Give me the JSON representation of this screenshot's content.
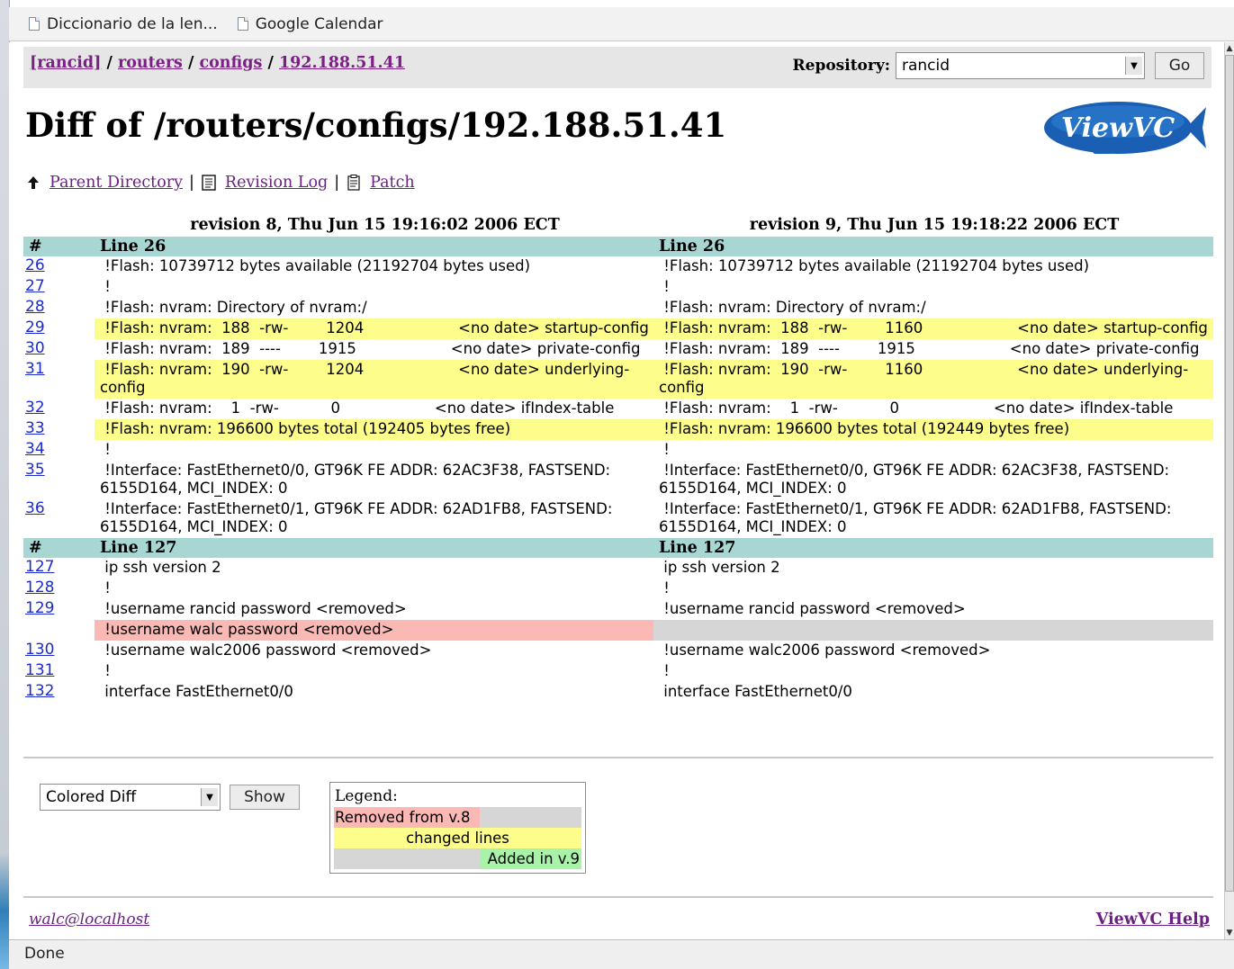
{
  "bookmarks": [
    {
      "label": "Diccionario de la len..."
    },
    {
      "label": "Google Calendar"
    }
  ],
  "breadcrumb": {
    "items": [
      "[rancid]",
      "routers",
      "configs",
      "192.188.51.41"
    ],
    "separator": "/"
  },
  "repository": {
    "label": "Repository:",
    "value": "rancid",
    "go_label": "Go"
  },
  "page_title": "Diff of /routers/configs/192.188.51.41",
  "logo_text": "ViewVC",
  "nav": {
    "parent": "Parent Directory",
    "log": "Revision Log",
    "patch": "Patch"
  },
  "diff": {
    "left_rev": "revision 8, Thu Jun 15 19:16:02 2006 ECT",
    "right_rev": "revision 9, Thu Jun 15 19:18:22 2006 ECT",
    "hash": "#",
    "hunks": [
      {
        "left_line": "Line 26",
        "right_line": "Line 26",
        "rows": [
          {
            "n": "26",
            "left": " !Flash: 10739712 bytes available (21192704 bytes used)",
            "right": " !Flash: 10739712 bytes available (21192704 bytes used)",
            "kind": "same"
          },
          {
            "n": "27",
            "left": " !",
            "right": " !",
            "kind": "same"
          },
          {
            "n": "28",
            "left": " !Flash: nvram: Directory of nvram:/",
            "right": " !Flash: nvram: Directory of nvram:/",
            "kind": "same"
          },
          {
            "n": "29",
            "left": " !Flash: nvram:  188  -rw-        1204                    <no date> startup-config",
            "right": " !Flash: nvram:  188  -rw-        1160                    <no date> startup-config",
            "kind": "changed"
          },
          {
            "n": "30",
            "left": " !Flash: nvram:  189  ----        1915                    <no date> private-config",
            "right": " !Flash: nvram:  189  ----        1915                    <no date> private-config",
            "kind": "same"
          },
          {
            "n": "31",
            "left": " !Flash: nvram:  190  -rw-        1204                    <no date> underlying-config",
            "right": " !Flash: nvram:  190  -rw-        1160                    <no date> underlying-config",
            "kind": "changed"
          },
          {
            "n": "32",
            "left": " !Flash: nvram:    1  -rw-           0                    <no date> ifIndex-table",
            "right": " !Flash: nvram:    1  -rw-           0                    <no date> ifIndex-table",
            "kind": "same"
          },
          {
            "n": "33",
            "left": " !Flash: nvram: 196600 bytes total (192405 bytes free)",
            "right": " !Flash: nvram: 196600 bytes total (192449 bytes free)",
            "kind": "changed"
          },
          {
            "n": "34",
            "left": " !",
            "right": " !",
            "kind": "same"
          },
          {
            "n": "35",
            "left": " !Interface: FastEthernet0/0, GT96K FE ADDR: 62AC3F38, FASTSEND: 6155D164, MCI_INDEX: 0",
            "right": " !Interface: FastEthernet0/0, GT96K FE ADDR: 62AC3F38, FASTSEND: 6155D164, MCI_INDEX: 0",
            "kind": "same"
          },
          {
            "n": "36",
            "left": " !Interface: FastEthernet0/1, GT96K FE ADDR: 62AD1FB8, FASTSEND: 6155D164, MCI_INDEX: 0",
            "right": " !Interface: FastEthernet0/1, GT96K FE ADDR: 62AD1FB8, FASTSEND: 6155D164, MCI_INDEX: 0",
            "kind": "same"
          }
        ]
      },
      {
        "left_line": "Line 127",
        "right_line": "Line 127",
        "rows": [
          {
            "n": "127",
            "left": " ip ssh version 2",
            "right": " ip ssh version 2",
            "kind": "same"
          },
          {
            "n": "128",
            "left": " !",
            "right": " !",
            "kind": "same"
          },
          {
            "n": "129",
            "left": " !username rancid password <removed>",
            "right": " !username rancid password <removed>",
            "kind": "same"
          },
          {
            "n": "",
            "left": " !username walc password <removed>",
            "right": "",
            "kind": "removed"
          },
          {
            "n": "130",
            "left": " !username walc2006 password <removed>",
            "right": " !username walc2006 password <removed>",
            "kind": "same"
          },
          {
            "n": "131",
            "left": " !",
            "right": " !",
            "kind": "same"
          },
          {
            "n": "132",
            "left": " interface FastEthernet0/0",
            "right": " interface FastEthernet0/0",
            "kind": "same"
          }
        ]
      }
    ]
  },
  "diff_format": {
    "value": "Colored Diff",
    "show_label": "Show"
  },
  "legend": {
    "title": "Legend:",
    "removed": "Removed from v.8",
    "changed": "changed lines",
    "added": "Added in v.9"
  },
  "footer": {
    "email": "walc@localhost",
    "help": "ViewVC Help"
  },
  "status": "Done",
  "colors": {
    "header_band": "#a7d6d3",
    "changed": "#fdfd8c",
    "removed": "#fbb9b5",
    "added": "#a8f3a8",
    "empty": "#d6d6d6",
    "link": "#1b2bd1",
    "visited": "#6a2182"
  }
}
